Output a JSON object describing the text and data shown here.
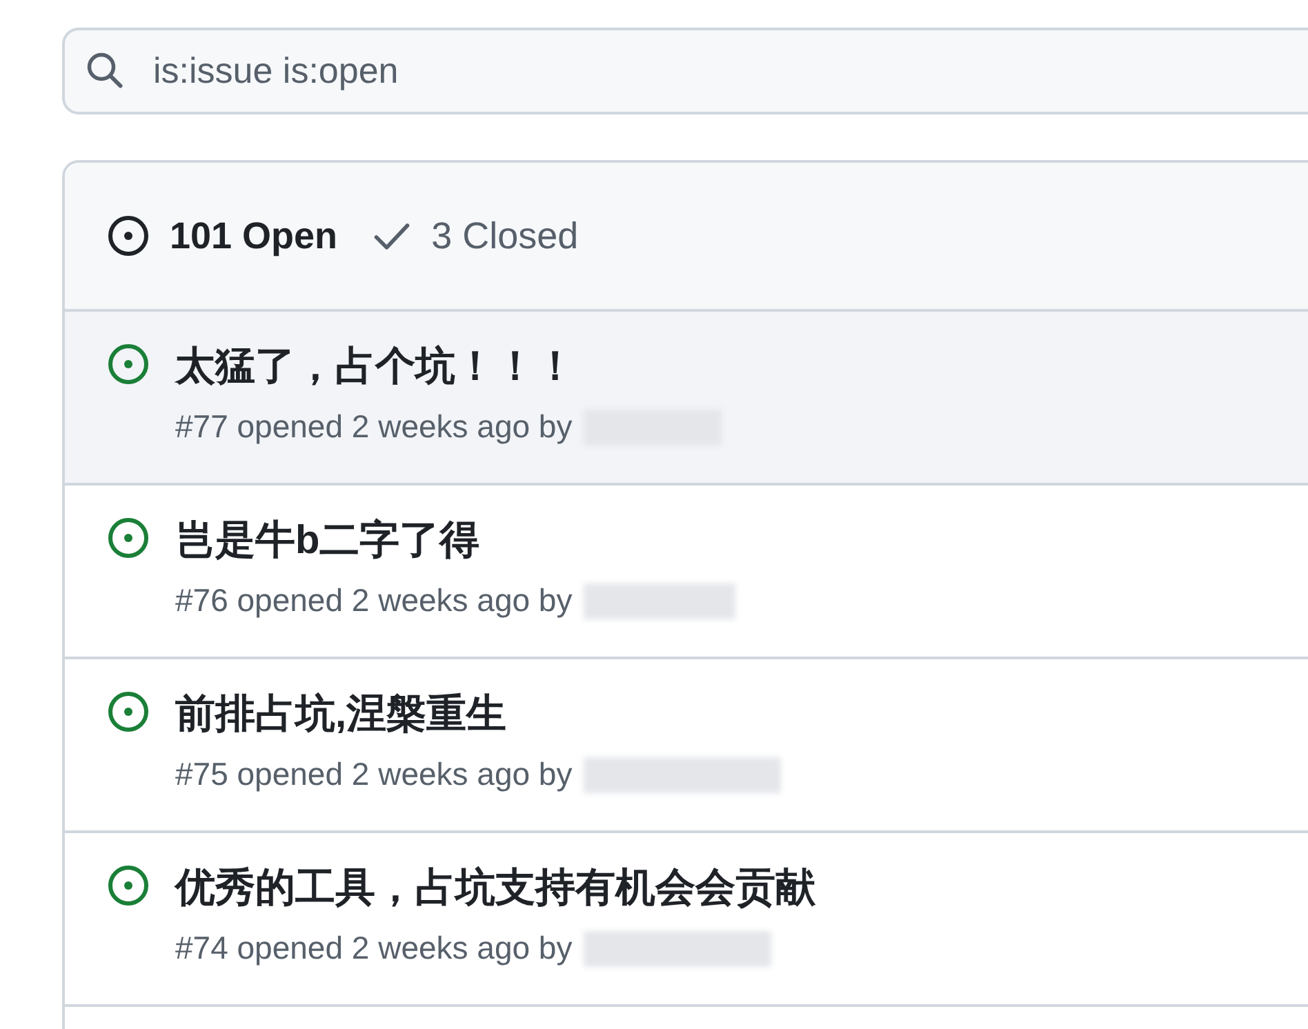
{
  "search": {
    "value": "is:issue is:open"
  },
  "tabs": [
    {
      "label": "101 Open",
      "selected": true,
      "kind": "open"
    },
    {
      "label": "3 Closed",
      "selected": false,
      "kind": "closed"
    }
  ],
  "issues": [
    {
      "title": "太猛了，占个坑！！！",
      "meta": "#77 opened 2 weeks ago by",
      "selected": true
    },
    {
      "title": "岂是牛b二字了得",
      "meta": "#76 opened 2 weeks ago by",
      "selected": false
    },
    {
      "title": "前排占坑,涅槃重生",
      "meta": "#75 opened 2 weeks ago by",
      "selected": false
    },
    {
      "title": "优秀的工具，占坑支持有机会会贡献",
      "meta": "#74 opened 2 weeks ago by",
      "selected": false
    }
  ]
}
